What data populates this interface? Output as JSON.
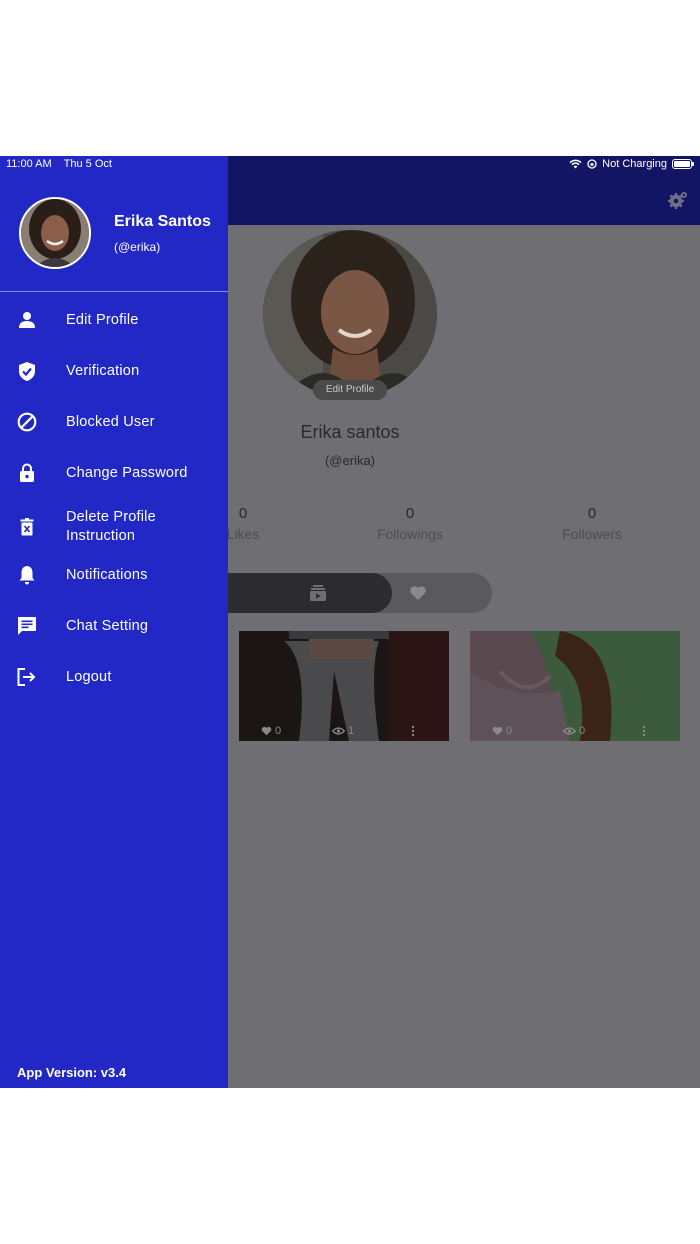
{
  "status_bar": {
    "time": "11:00 AM",
    "date": "Thu 5 Oct",
    "charging_text": "Not Charging",
    "battery_level": 1.0
  },
  "drawer": {
    "user_name": "Erika Santos",
    "user_handle": "(@erika)",
    "menu": [
      {
        "label": "Edit Profile",
        "icon": "person-icon"
      },
      {
        "label": "Verification",
        "icon": "shield-check-icon"
      },
      {
        "label": "Blocked User",
        "icon": "block-icon"
      },
      {
        "label": "Change Password",
        "icon": "lock-icon"
      },
      {
        "label": "Delete Profile Instruction",
        "icon": "delete-icon"
      },
      {
        "label": "Notifications",
        "icon": "bell-icon"
      },
      {
        "label": "Chat Setting",
        "icon": "chat-icon"
      },
      {
        "label": "Logout",
        "icon": "logout-icon"
      }
    ],
    "app_version": "App Version:  v3.4"
  },
  "profile": {
    "edit_profile_label": "Edit Profile",
    "name": "Erika santos",
    "handle": "(@erika)",
    "stats": [
      {
        "value": "0",
        "label": "Likes"
      },
      {
        "value": "0",
        "label": "Followings"
      },
      {
        "value": "0",
        "label": "Followers"
      }
    ],
    "videos": [
      {
        "likes": "0",
        "views": "1"
      },
      {
        "likes": "0",
        "views": "0"
      }
    ]
  },
  "colors": {
    "drawer": "#2128c6",
    "header": "#121563",
    "overlay": "#6f6f73"
  }
}
